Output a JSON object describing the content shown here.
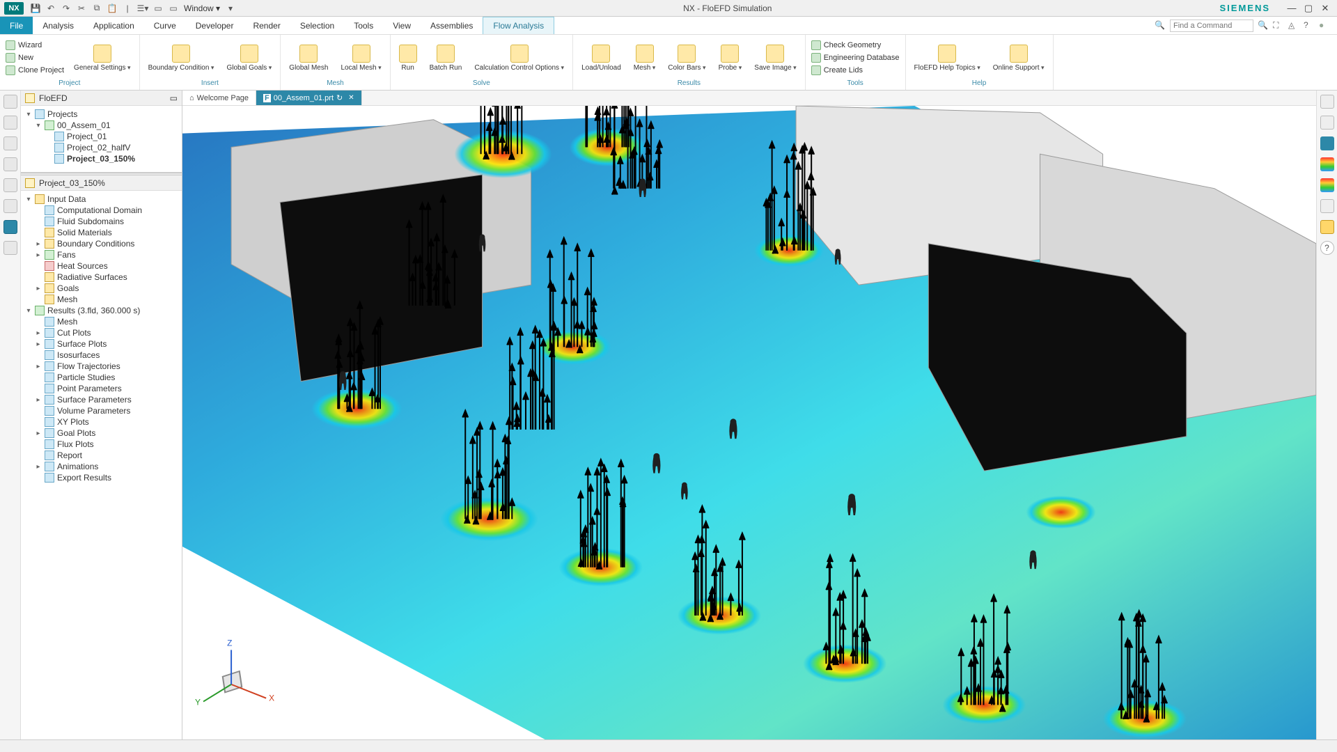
{
  "app": {
    "logo": "NX",
    "title": "NX - FloEFD Simulation",
    "brand": "SIEMENS"
  },
  "qat": {
    "window_label": "Window"
  },
  "menu": {
    "items": [
      "File",
      "Analysis",
      "Application",
      "Curve",
      "Developer",
      "Render",
      "Selection",
      "Tools",
      "View",
      "Assemblies",
      "Flow Analysis"
    ],
    "active": "Flow Analysis",
    "search_placeholder": "Find a Command"
  },
  "ribbon": {
    "groups": [
      {
        "label": "Project",
        "small": [
          "Wizard",
          "New",
          "Clone Project"
        ],
        "big": [
          {
            "label": "General Settings",
            "drop": true
          }
        ]
      },
      {
        "label": "Insert",
        "big": [
          {
            "label": "Boundary Condition",
            "drop": true
          },
          {
            "label": "Global Goals",
            "drop": true
          }
        ]
      },
      {
        "label": "Mesh",
        "big": [
          {
            "label": "Global Mesh"
          },
          {
            "label": "Local Mesh",
            "drop": true
          }
        ]
      },
      {
        "label": "Solve",
        "big": [
          {
            "label": "Run"
          },
          {
            "label": "Batch Run"
          },
          {
            "label": "Calculation Control Options",
            "drop": true
          }
        ]
      },
      {
        "label": "Results",
        "big": [
          {
            "label": "Load/Unload"
          },
          {
            "label": "Mesh",
            "drop": true
          },
          {
            "label": "Color Bars",
            "drop": true
          },
          {
            "label": "Probe",
            "drop": true
          },
          {
            "label": "Save Image",
            "drop": true
          }
        ]
      },
      {
        "label": "Tools",
        "small": [
          "Check Geometry",
          "Engineering Database",
          "Create Lids"
        ]
      },
      {
        "label": "Help",
        "big": [
          {
            "label": "FloEFD Help Topics",
            "drop": true
          },
          {
            "label": "Online Support",
            "drop": true
          }
        ]
      }
    ]
  },
  "sidepanel": {
    "title": "FloEFD",
    "projects_root": "Projects",
    "assembly": "00_Assem_01",
    "projects": [
      "Project_01",
      "Project_02_halfV",
      "Project_03_150%"
    ],
    "active_project": "Project_03_150%",
    "input_root": "Input Data",
    "input_items": [
      "Computational Domain",
      "Fluid Subdomains",
      "Solid Materials",
      "Boundary Conditions",
      "Fans",
      "Heat Sources",
      "Radiative Surfaces",
      "Goals",
      "Mesh"
    ],
    "results_root": "Results (3.fld, 360.000 s)",
    "results_items": [
      "Mesh",
      "Cut Plots",
      "Surface Plots",
      "Isosurfaces",
      "Flow Trajectories",
      "Particle Studies",
      "Point Parameters",
      "Surface Parameters",
      "Volume Parameters",
      "XY Plots",
      "Goal Plots",
      "Flux Plots",
      "Report",
      "Animations",
      "Export Results"
    ]
  },
  "doctabs": {
    "welcome": "Welcome Page",
    "active_file": "00_Assem_01.prt"
  },
  "triad": {
    "x": "X",
    "y": "Y",
    "z": "Z"
  }
}
